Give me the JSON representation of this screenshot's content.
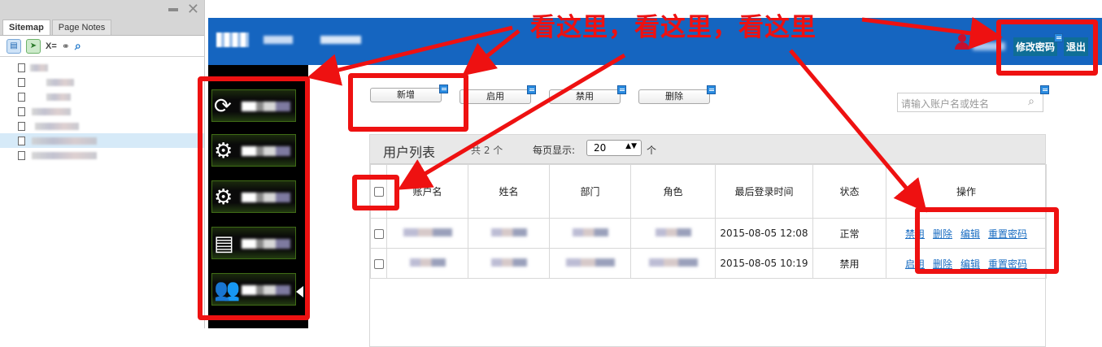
{
  "sitemap": {
    "tabs": [
      "Sitemap",
      "Page Notes"
    ],
    "toolbar_text": "X="
  },
  "header": {
    "change_password": "修改密码",
    "logout": "退出"
  },
  "actions": {
    "add": "新增",
    "enable": "启用",
    "disable": "禁用",
    "delete": "删除"
  },
  "search": {
    "placeholder": "请输入账户名或姓名"
  },
  "list": {
    "title": "用户列表",
    "count": "共 2 个",
    "per_page_label": "每页显示:",
    "per_page_value": "20",
    "unit": "个"
  },
  "columns": [
    "账户名",
    "姓名",
    "部门",
    "角色",
    "最后登录时间",
    "状态",
    "操作"
  ],
  "rows": [
    {
      "last_login": "2015-08-05  12:08",
      "status": "正常",
      "ops": [
        "禁用",
        "删除",
        "编辑",
        "重置密码"
      ]
    },
    {
      "last_login": "2015-08-05  10:19",
      "status": "禁用",
      "ops": [
        "启用",
        "删除",
        "编辑",
        "重置密码"
      ]
    }
  ],
  "annotation": {
    "text": "看这里，看这里，看这里",
    "color": "#ee1111"
  },
  "colors": {
    "header": "#1565c0",
    "sidenav": "#000000",
    "link": "#1a6dc2"
  }
}
